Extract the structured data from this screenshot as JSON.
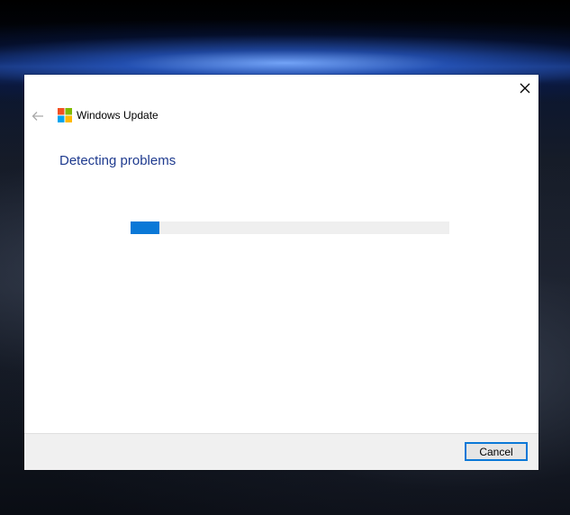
{
  "window": {
    "title": "Windows Update",
    "heading": "Detecting problems"
  },
  "progress": {
    "fraction": 0.09,
    "fill_color": "#0a78d7",
    "track_color": "#efefef"
  },
  "footer": {
    "cancel_label": "Cancel"
  },
  "colors": {
    "accent": "#0a78d7",
    "heading": "#1f3b8f",
    "logo_red": "#f25022",
    "logo_green": "#7fba00",
    "logo_blue": "#00a4ef",
    "logo_yellow": "#ffb900"
  },
  "icons": {
    "close": "close-icon",
    "back": "back-arrow-icon",
    "logo": "windows-logo-icon"
  }
}
